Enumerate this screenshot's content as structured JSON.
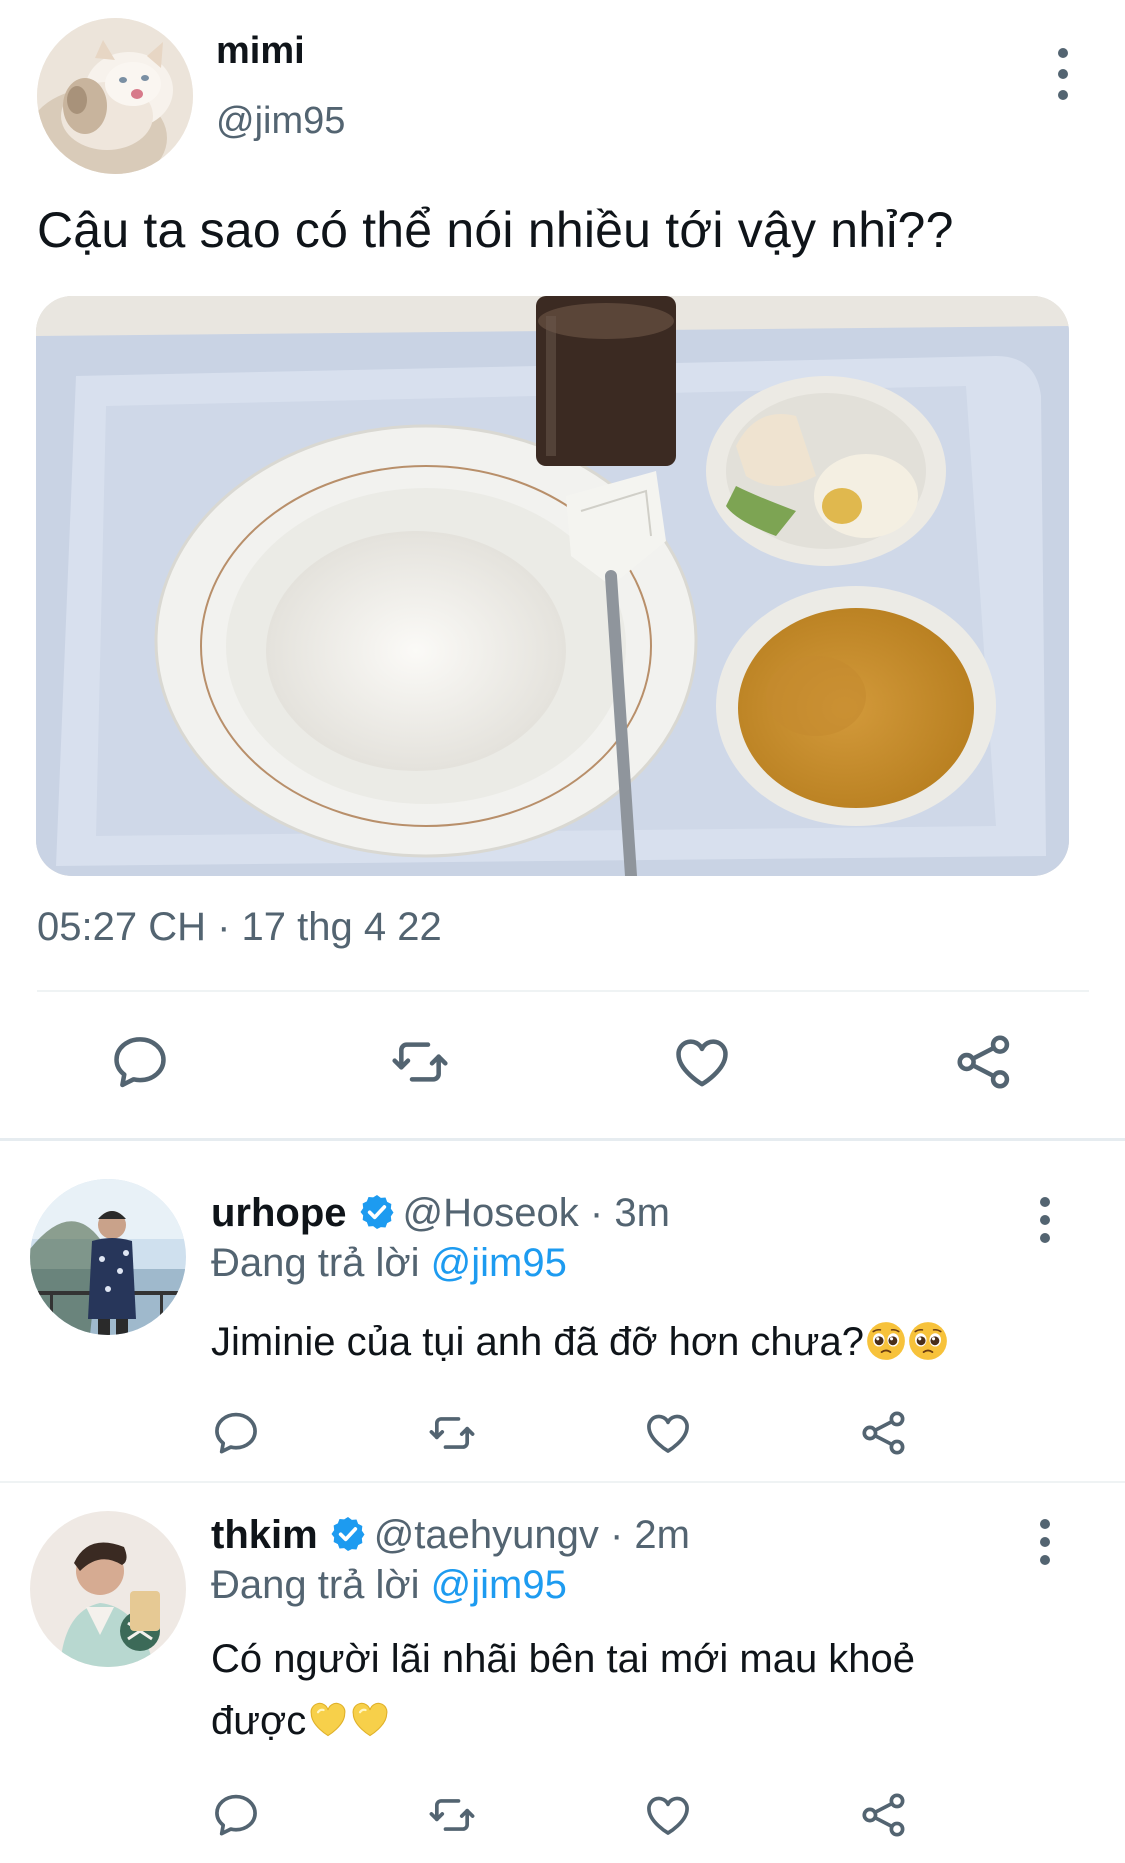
{
  "main_tweet": {
    "display_name": "mimi",
    "handle": "@jim95",
    "avatar_icon": "cat-avatar",
    "text": "Cậu ta sao có thể nói nhiều tới vậy nhỉ??",
    "photo": "tray-with-rice-porridge-soup-and-egg",
    "timestamp": "05:27 CH · 17 thg 4 22",
    "actions": [
      "reply-icon",
      "retweet-icon",
      "like-icon",
      "share-icon"
    ]
  },
  "replies": [
    {
      "display_name": "urhope",
      "handle_time": "@Hoseok · 3m",
      "verified": true,
      "replying_prefix": "Đang trả lời",
      "replying_to": "@jim95",
      "text": "Jiminie của tụi anh đã đỡ hơn chưa?",
      "emoji": [
        "pleading-face",
        "pleading-face"
      ],
      "actions": [
        "reply-icon",
        "retweet-icon",
        "like-icon",
        "share-icon"
      ]
    },
    {
      "display_name": "thkim",
      "handle_time": "@taehyungv · 2m",
      "verified": true,
      "replying_prefix": "Đang trả lời",
      "replying_to": "@jim95",
      "text_line1": "Có người lãi nhãi bên tai mới mau khoẻ",
      "text_line2": "được",
      "emoji": [
        "yellow-heart",
        "yellow-heart"
      ],
      "actions": [
        "reply-icon",
        "retweet-icon",
        "like-icon",
        "share-icon"
      ]
    }
  ],
  "colors": {
    "text": "#0f1419",
    "secondary": "#536471",
    "link": "#1d9bf0",
    "verified": "#1d9bf0",
    "divider": "#eff3f4"
  }
}
